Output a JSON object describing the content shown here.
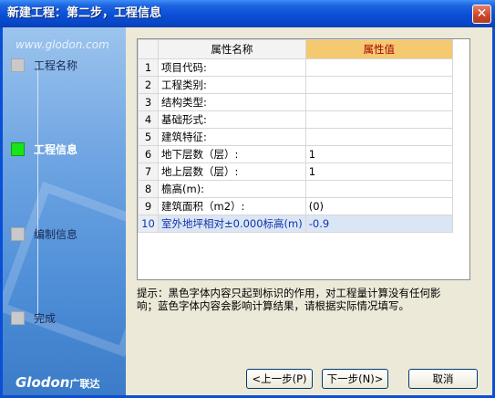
{
  "window": {
    "title": "新建工程：第二步，工程信息",
    "close_label": "✕"
  },
  "sidebar": {
    "url": "www.glodon.com",
    "logo": "Glodon",
    "logo_cn": "广联达",
    "steps": [
      {
        "label": "工程名称",
        "active": false
      },
      {
        "label": "工程信息",
        "active": true
      },
      {
        "label": "编制信息",
        "active": false
      },
      {
        "label": "完成",
        "active": false
      }
    ]
  },
  "grid": {
    "headers": {
      "name": "属性名称",
      "value": "属性值"
    },
    "rows": [
      {
        "num": "1",
        "name": "项目代码:",
        "value": ""
      },
      {
        "num": "2",
        "name": "工程类别:",
        "value": ""
      },
      {
        "num": "3",
        "name": "结构类型:",
        "value": ""
      },
      {
        "num": "4",
        "name": "基础形式:",
        "value": ""
      },
      {
        "num": "5",
        "name": "建筑特征:",
        "value": ""
      },
      {
        "num": "6",
        "name": "地下层数（层）:",
        "value": "1"
      },
      {
        "num": "7",
        "name": "地上层数（层）:",
        "value": "1"
      },
      {
        "num": "8",
        "name": "檐高(m):",
        "value": ""
      },
      {
        "num": "9",
        "name": "建筑面积（m2）:",
        "value": "(0)"
      },
      {
        "num": "10",
        "name": "室外地坪相对±0.000标高(m)",
        "value": "-0.9"
      }
    ]
  },
  "hint": {
    "line1": "提示：黑色字体内容只起到标识的作用，对工程量计算没有任何影",
    "line2": "响；蓝色字体内容会影响计算结果，请根据实际情况填写。"
  },
  "buttons": {
    "prev": "<上一步(P)",
    "next": "下一步(N)>",
    "cancel": "取消"
  }
}
